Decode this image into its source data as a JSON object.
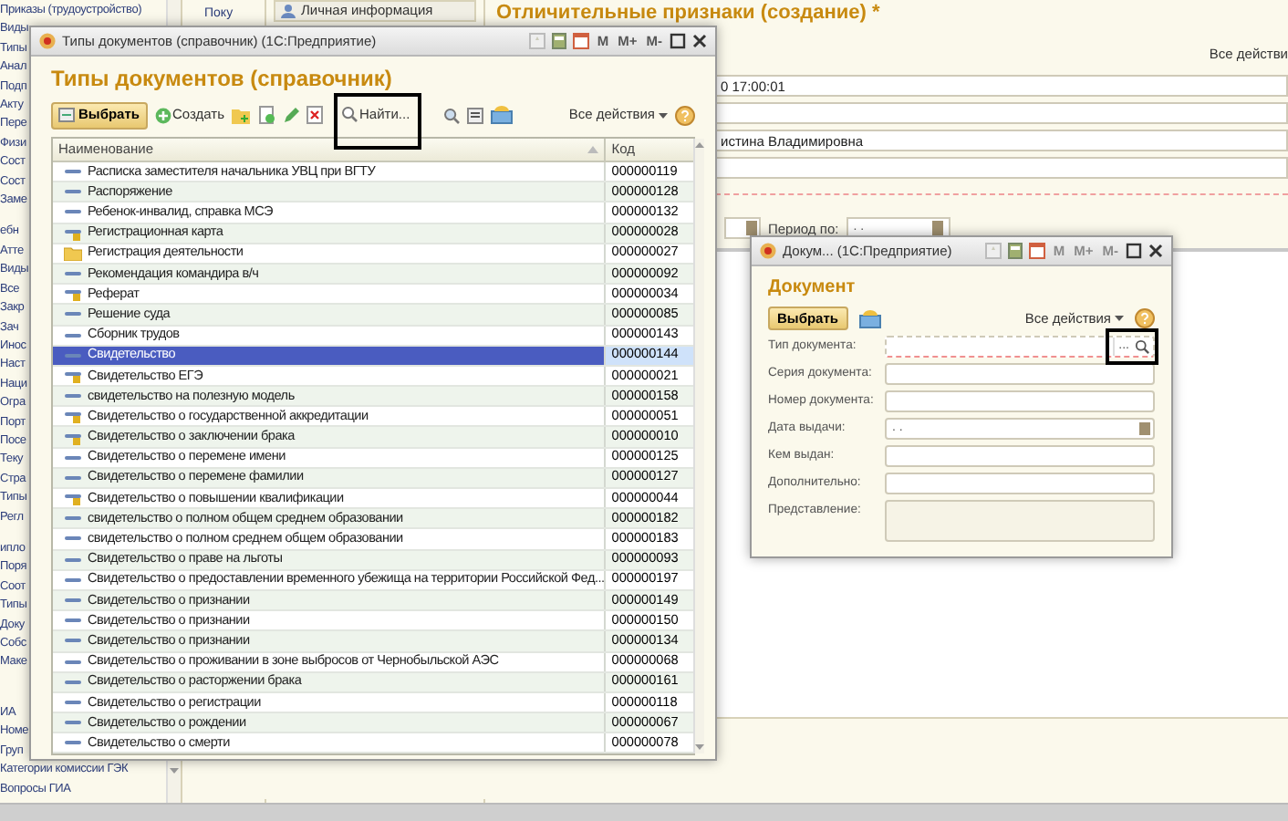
{
  "sidebar": {
    "groups": [
      {
        "items": [
          "Приказы (трудоустройство)",
          "Виды",
          "Типы",
          "Анал",
          "Подп",
          "Акту",
          "Пере",
          "Физи",
          "Сост",
          "Сост",
          "Заме"
        ]
      },
      {
        "items": [
          "ебн",
          "Атте",
          "Виды",
          "Все",
          "Закр",
          "Зач",
          "Инос",
          "Наст",
          "Наци",
          "Огра",
          "Порт",
          "Посе",
          "Теку",
          "Стра",
          "Типы",
          "Регл"
        ]
      },
      {
        "items": [
          "ипло",
          "Поря",
          "Соот",
          "Типы",
          "Доку",
          "Собс",
          "Маке"
        ]
      },
      {
        "items": [
          "ИА",
          "Номе",
          "Груп",
          "Категории комиссии ГЭК",
          "Вопросы ГИА"
        ]
      }
    ]
  },
  "middle_column": {
    "items": [
      "Поку"
    ]
  },
  "info_panel": {
    "label": "Личная информация"
  },
  "main_form": {
    "title": "Отличительные признаки (создание) *",
    "all_actions": "Все действи",
    "fields": [
      {
        "kind": "filled",
        "value": "0 17:00:01"
      },
      {
        "kind": "blank"
      },
      {
        "kind": "filled",
        "value": "истина Владимировна"
      },
      {
        "kind": "blank"
      }
    ],
    "period_to": {
      "label": "Период по:",
      "value": ". ."
    }
  },
  "catalog_window": {
    "title": "Типы документов (справочник)  (1С:Предприятие)",
    "memory_buttons": [
      "M",
      "M+",
      "M-"
    ],
    "heading": "Типы документов (справочник)",
    "toolbar": {
      "select": "Выбрать",
      "create": "Создать",
      "find": "Найти...",
      "all_actions": "Все действия"
    },
    "table": {
      "columns": [
        "Наименование",
        "Код"
      ],
      "rows": [
        {
          "name": "Расписка заместителя начальника УВЦ при ВГТУ",
          "code": "000000119",
          "kind": "item",
          "selected": false
        },
        {
          "name": "Распоряжение",
          "code": "000000128",
          "kind": "item",
          "selected": false
        },
        {
          "name": "Ребенок-инвалид, справка МСЭ",
          "code": "000000132",
          "kind": "item",
          "selected": false
        },
        {
          "name": "Регистрационная карта",
          "code": "000000028",
          "kind": "marked",
          "selected": false
        },
        {
          "name": "Регистрация деятельности",
          "code": "000000027",
          "kind": "folder",
          "selected": false
        },
        {
          "name": "Рекомендация командира в/ч",
          "code": "000000092",
          "kind": "item",
          "selected": false
        },
        {
          "name": "Реферат",
          "code": "000000034",
          "kind": "marked",
          "selected": false
        },
        {
          "name": "Решение суда",
          "code": "000000085",
          "kind": "item",
          "selected": false
        },
        {
          "name": "Сборник трудов",
          "code": "000000143",
          "kind": "item",
          "selected": false
        },
        {
          "name": "Свидетельство",
          "code": "000000144",
          "kind": "item",
          "selected": true
        },
        {
          "name": "Свидетельство ЕГЭ",
          "code": "000000021",
          "kind": "marked",
          "selected": false
        },
        {
          "name": "свидетельство на полезную модель",
          "code": "000000158",
          "kind": "item",
          "selected": false
        },
        {
          "name": "Свидетельство о государственной аккредитации",
          "code": "000000051",
          "kind": "marked",
          "selected": false
        },
        {
          "name": "Свидетельство о заключении брака",
          "code": "000000010",
          "kind": "marked",
          "selected": false
        },
        {
          "name": "Свидетельство о перемене имени",
          "code": "000000125",
          "kind": "item",
          "selected": false
        },
        {
          "name": "Свидетельство о перемене фамилии",
          "code": "000000127",
          "kind": "item",
          "selected": false
        },
        {
          "name": "Свидетельство о повышении квалификации",
          "code": "000000044",
          "kind": "marked",
          "selected": false
        },
        {
          "name": "свидетельство о полном общем среднем образовании",
          "code": "000000182",
          "kind": "item",
          "selected": false
        },
        {
          "name": "свидетельство о полном среднем общем образовании",
          "code": "000000183",
          "kind": "item",
          "selected": false
        },
        {
          "name": "Свидетельство о праве на льготы",
          "code": "000000093",
          "kind": "item",
          "selected": false
        },
        {
          "name": "Свидетельство о предоставлении временного убежища на территории Российской Фед...",
          "code": "000000197",
          "kind": "item",
          "selected": false
        },
        {
          "name": "Свидетельство о признании",
          "code": "000000149",
          "kind": "item",
          "selected": false
        },
        {
          "name": "Свидетельство о признании",
          "code": "000000150",
          "kind": "item",
          "selected": false
        },
        {
          "name": "Свидетельство о признании",
          "code": "000000134",
          "kind": "item",
          "selected": false
        },
        {
          "name": "Свидетельство о проживании в зоне выбросов от Чернобыльской АЭС",
          "code": "000000068",
          "kind": "item",
          "selected": false
        },
        {
          "name": "Свидетельство о расторжении брака",
          "code": "000000161",
          "kind": "item",
          "selected": false
        },
        {
          "name": "Свидетельство о регистрации",
          "code": "000000118",
          "kind": "item",
          "selected": false
        },
        {
          "name": "Свидетельство о рождении",
          "code": "000000067",
          "kind": "item",
          "selected": false
        },
        {
          "name": "Свидетельство о смерти",
          "code": "000000078",
          "kind": "item",
          "selected": false
        }
      ]
    }
  },
  "document_window": {
    "title": "Докум... (1С:Предприятие)",
    "memory_buttons": [
      "M",
      "M+",
      "M-"
    ],
    "heading": "Документ",
    "select": "Выбрать",
    "all_actions": "Все действия",
    "fields": [
      {
        "label": "Тип документа:",
        "kind": "choice",
        "invalid": true,
        "choose_button": "..."
      },
      {
        "label": "Серия документа:",
        "kind": "text",
        "invalid": false
      },
      {
        "label": "Номер документа:",
        "kind": "text",
        "invalid": false
      },
      {
        "label": "Дата выдачи:",
        "kind": "date",
        "value": ". .",
        "invalid": false
      },
      {
        "label": "Кем выдан:",
        "kind": "text",
        "invalid": false
      },
      {
        "label": "Дополнительно:",
        "kind": "text",
        "invalid": false
      },
      {
        "label": "Представление:",
        "kind": "area",
        "invalid": false
      }
    ]
  }
}
